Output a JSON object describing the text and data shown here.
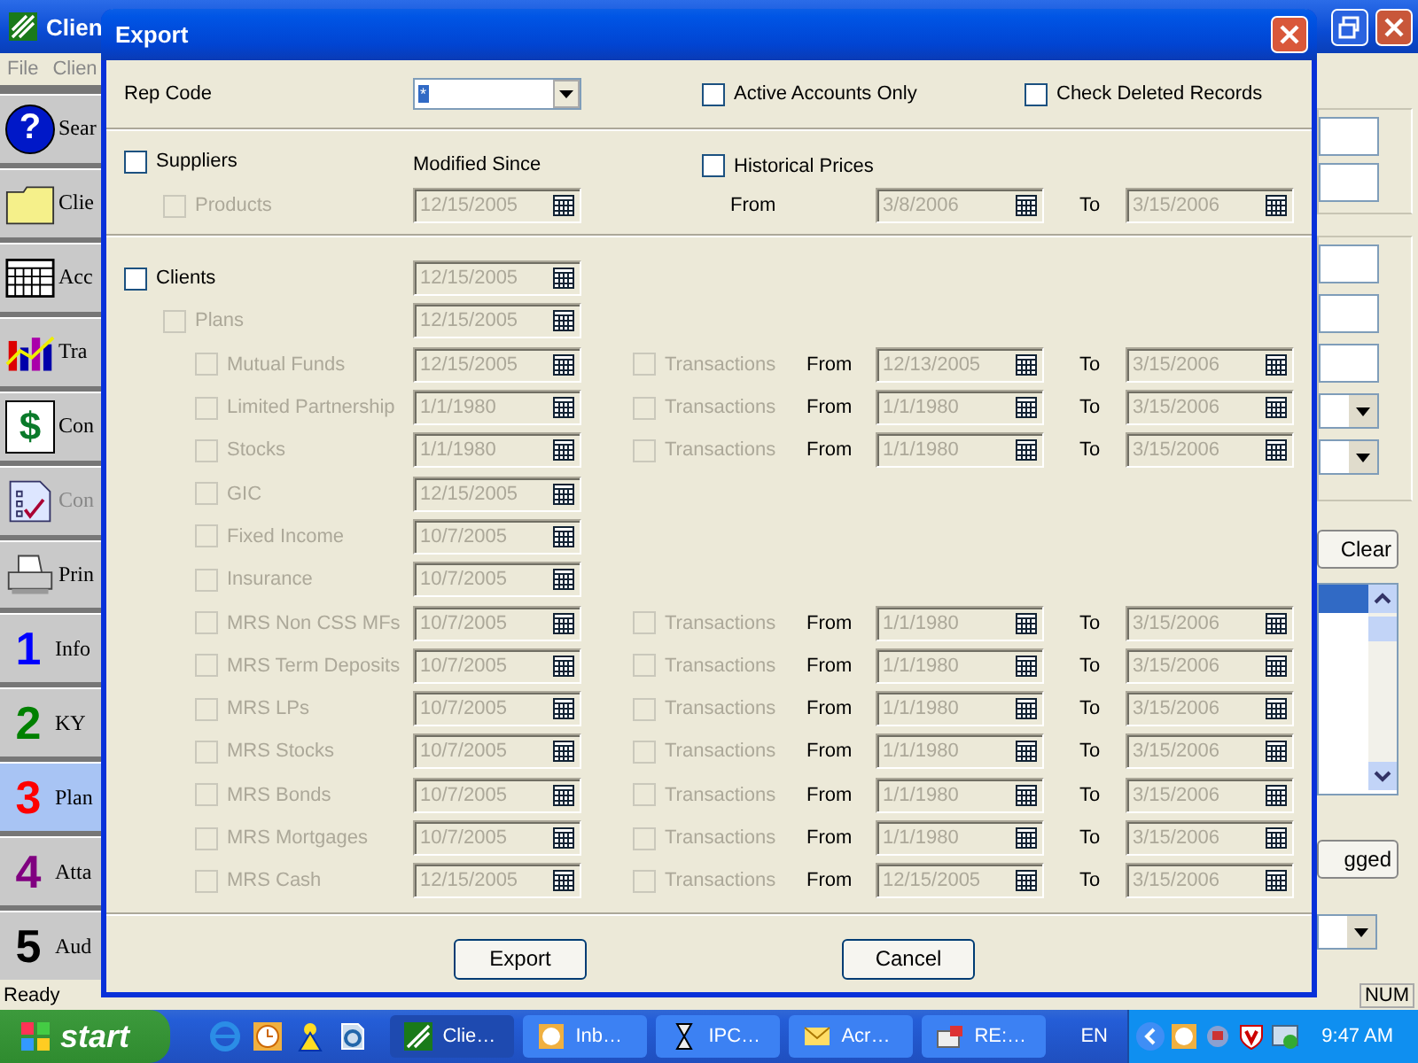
{
  "app": {
    "title": "Clien",
    "menu": [
      "File",
      "Clien"
    ],
    "sidebar": [
      {
        "kind": "badge",
        "glyph": "?",
        "label": "Sear",
        "selected": false,
        "disabled": false
      },
      {
        "kind": "folder",
        "label": "Clie",
        "selected": false,
        "disabled": false
      },
      {
        "kind": "grid",
        "label": "Acc",
        "selected": false,
        "disabled": false
      },
      {
        "kind": "chart",
        "label": "Tra",
        "selected": false,
        "disabled": false
      },
      {
        "kind": "glyph",
        "glyph": "$",
        "label": "Con",
        "selected": false,
        "disabled": false
      },
      {
        "kind": "checklist",
        "label": "Con",
        "selected": false,
        "disabled": true
      },
      {
        "kind": "printer",
        "label": "Prin",
        "selected": false,
        "disabled": false
      },
      {
        "kind": "number",
        "glyph": "1",
        "color": "#0000ff",
        "label": "Info",
        "selected": false,
        "disabled": false
      },
      {
        "kind": "number",
        "glyph": "2",
        "color": "#008000",
        "label": "KY",
        "selected": false,
        "disabled": false
      },
      {
        "kind": "number",
        "glyph": "3",
        "color": "#ff0000",
        "label": "Plan",
        "selected": true,
        "disabled": false
      },
      {
        "kind": "number",
        "glyph": "4",
        "color": "#800080",
        "label": "Atta",
        "selected": false,
        "disabled": false
      },
      {
        "kind": "number",
        "glyph": "5",
        "color": "#000000",
        "label": "Aud",
        "selected": false,
        "disabled": false
      }
    ],
    "clear_button": "Clear",
    "flag_button": "gged",
    "status": "Ready",
    "num": "NUM"
  },
  "dialog": {
    "title": "Export",
    "rep_code": {
      "label": "Rep Code",
      "value": "*"
    },
    "active_accounts": {
      "label": "Active Accounts Only",
      "checked": false
    },
    "check_deleted": {
      "label": "Check Deleted Records",
      "checked": false
    },
    "suppliers": {
      "label": "Suppliers",
      "checked": false,
      "disabled": false
    },
    "modified_since": "Modified Since",
    "historical_prices": {
      "label": "Historical Prices",
      "checked": false,
      "disabled": false
    },
    "products": {
      "label": "Products",
      "checked": false,
      "disabled": true,
      "date": "12/15/2005",
      "from_label": "From",
      "from": "3/8/2006",
      "to_label": "To",
      "to": "3/15/2006"
    },
    "clients": {
      "label": "Clients",
      "checked": false,
      "disabled": false,
      "date": "12/15/2005",
      "children": [
        {
          "label": "Plans",
          "checked": false,
          "disabled": true,
          "date": "12/15/2005",
          "children": [
            {
              "label": "Mutual Funds",
              "checked": false,
              "disabled": true,
              "date": "12/15/2005",
              "transactions": {
                "label": "Transactions",
                "checked": false,
                "disabled": true,
                "from_label": "From",
                "from": "12/13/2005",
                "to_label": "To",
                "to": "3/15/2006"
              }
            },
            {
              "label": "Limited Partnership",
              "checked": false,
              "disabled": true,
              "date": "1/1/1980",
              "transactions": {
                "label": "Transactions",
                "checked": false,
                "disabled": true,
                "from_label": "From",
                "from": "1/1/1980",
                "to_label": "To",
                "to": "3/15/2006"
              }
            },
            {
              "label": "Stocks",
              "checked": false,
              "disabled": true,
              "date": "1/1/1980",
              "transactions": {
                "label": "Transactions",
                "checked": false,
                "disabled": true,
                "from_label": "From",
                "from": "1/1/1980",
                "to_label": "To",
                "to": "3/15/2006"
              }
            },
            {
              "label": "GIC",
              "checked": false,
              "disabled": true,
              "date": "12/15/2005"
            },
            {
              "label": "Fixed Income",
              "checked": false,
              "disabled": true,
              "date": "10/7/2005"
            },
            {
              "label": "Insurance",
              "checked": false,
              "disabled": true,
              "date": "10/7/2005"
            },
            {
              "label": "MRS Non CSS MFs",
              "checked": false,
              "disabled": true,
              "date": "10/7/2005",
              "transactions": {
                "label": "Transactions",
                "checked": false,
                "disabled": true,
                "from_label": "From",
                "from": "1/1/1980",
                "to_label": "To",
                "to": "3/15/2006"
              }
            },
            {
              "label": "MRS Term Deposits",
              "checked": false,
              "disabled": true,
              "date": "10/7/2005",
              "transactions": {
                "label": "Transactions",
                "checked": false,
                "disabled": true,
                "from_label": "From",
                "from": "1/1/1980",
                "to_label": "To",
                "to": "3/15/2006"
              }
            },
            {
              "label": "MRS LPs",
              "checked": false,
              "disabled": true,
              "date": "10/7/2005",
              "transactions": {
                "label": "Transactions",
                "checked": false,
                "disabled": true,
                "from_label": "From",
                "from": "1/1/1980",
                "to_label": "To",
                "to": "3/15/2006"
              }
            },
            {
              "label": "MRS Stocks",
              "checked": false,
              "disabled": true,
              "date": "10/7/2005",
              "transactions": {
                "label": "Transactions",
                "checked": false,
                "disabled": true,
                "from_label": "From",
                "from": "1/1/1980",
                "to_label": "To",
                "to": "3/15/2006"
              }
            },
            {
              "label": "MRS Bonds",
              "checked": false,
              "disabled": true,
              "date": "10/7/2005",
              "transactions": {
                "label": "Transactions",
                "checked": false,
                "disabled": true,
                "from_label": "From",
                "from": "1/1/1980",
                "to_label": "To",
                "to": "3/15/2006"
              }
            },
            {
              "label": "MRS Mortgages",
              "checked": false,
              "disabled": true,
              "date": "10/7/2005",
              "transactions": {
                "label": "Transactions",
                "checked": false,
                "disabled": true,
                "from_label": "From",
                "from": "1/1/1980",
                "to_label": "To",
                "to": "3/15/2006"
              }
            },
            {
              "label": "MRS Cash",
              "checked": false,
              "disabled": true,
              "date": "12/15/2005",
              "transactions": {
                "label": "Transactions",
                "checked": false,
                "disabled": true,
                "from_label": "From",
                "from": "12/15/2005",
                "to_label": "To",
                "to": "3/15/2006"
              }
            }
          ]
        }
      ]
    },
    "buttons": [
      "Export",
      "Cancel"
    ]
  },
  "taskbar": {
    "start": "start",
    "quick_launch": [
      {
        "kind": "globe"
      },
      {
        "kind": "clock"
      },
      {
        "kind": "person"
      },
      {
        "kind": "page"
      }
    ],
    "tasks": [
      {
        "label": "Clie…",
        "kind": "app",
        "selected": true
      },
      {
        "label": "Inb…",
        "kind": "clock",
        "selected": false
      },
      {
        "label": "IPC…",
        "kind": "hourglass",
        "selected": false
      },
      {
        "label": "Acr…",
        "kind": "envelope",
        "selected": false
      },
      {
        "label": "RE:…",
        "kind": "mail",
        "selected": false
      }
    ],
    "language": "EN",
    "clock": "9:47 AM"
  }
}
